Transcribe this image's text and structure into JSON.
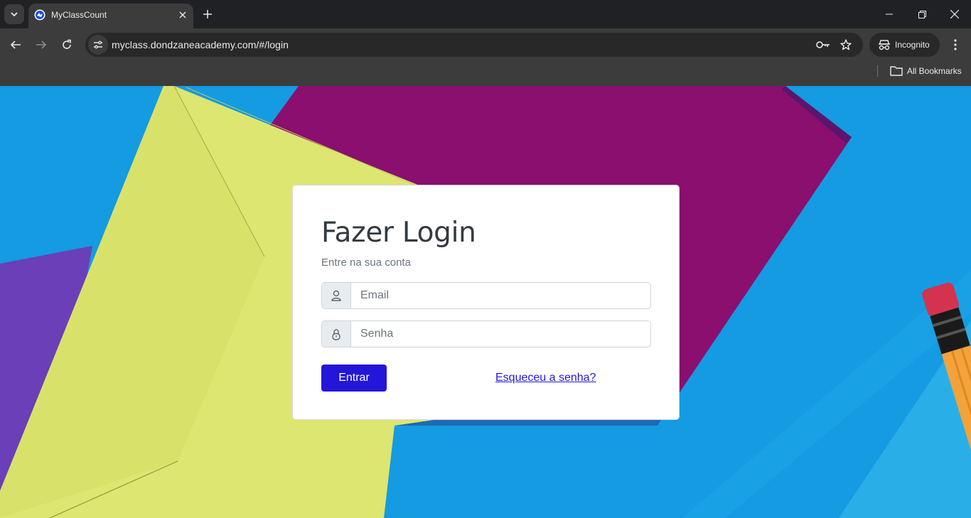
{
  "browser": {
    "tab_title": "MyClassCount",
    "url": "myclass.dondzaneacademy.com/#/login",
    "incognito_label": "Incognito",
    "all_bookmarks_label": "All Bookmarks"
  },
  "login": {
    "title": "Fazer Login",
    "subtitle": "Entre na sua conta",
    "email_placeholder": "Email",
    "password_placeholder": "Senha",
    "submit_label": "Entrar",
    "forgot_link": "Esqueceu a senha?"
  },
  "icons": [
    "tab-search-icon",
    "favicon-icon",
    "close-icon",
    "plus-icon",
    "minimize-icon",
    "restore-icon",
    "window-close-icon",
    "back-icon",
    "forward-icon",
    "reload-icon",
    "site-info-icon",
    "key-icon",
    "star-icon",
    "incognito-icon",
    "kebab-menu-icon",
    "folder-icon",
    "user-icon",
    "lock-icon"
  ],
  "colors": {
    "accent": "#2316d8",
    "background_blue": "#159ae0",
    "envelope_yellow": "#dde670",
    "envelope_magenta": "#8a0f6e",
    "paper_purple": "#6a3fb8"
  }
}
